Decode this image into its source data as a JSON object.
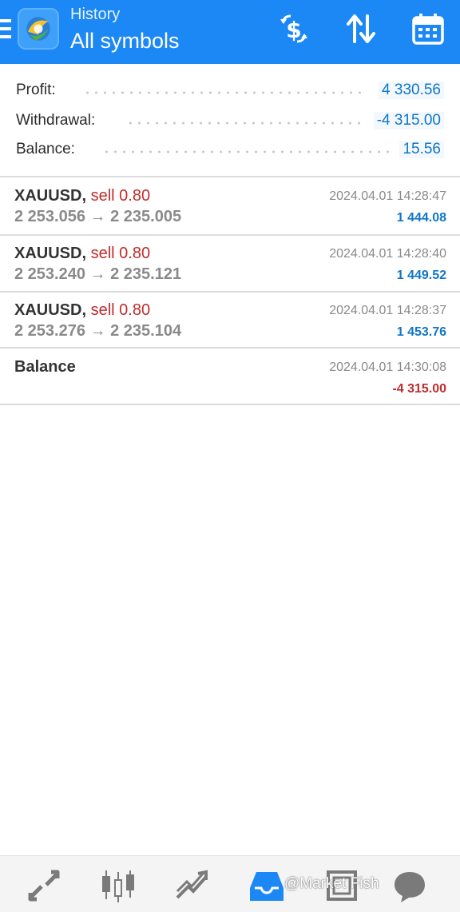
{
  "header": {
    "subtitle": "History",
    "title": "All symbols",
    "icons": [
      "menu-icon",
      "metatrader-logo",
      "dollar-exchange-icon",
      "sort-icon",
      "calendar-icon"
    ],
    "bg_color": "#1c88f5"
  },
  "summary": {
    "profit_label": "Profit:",
    "profit_value": "4 330.56",
    "withdrawal_label": "Withdrawal:",
    "withdrawal_value": "-4 315.00",
    "balance_label": "Balance:",
    "balance_value": "15.56",
    "value_color": "#1176c7"
  },
  "deals": [
    {
      "symbol": "XAUUSD,",
      "side": "sell 0.80",
      "prices": "2 253.056 → 2 235.005",
      "time": "2024.04.01 14:28:47",
      "profit": "1 444.08"
    },
    {
      "symbol": "XAUUSD,",
      "side": "sell 0.80",
      "prices": "2 253.240 → 2 235.121",
      "time": "2024.04.01 14:28:40",
      "profit": "1 449.52"
    },
    {
      "symbol": "XAUUSD,",
      "side": "sell 0.80",
      "prices": "2 253.276 → 2 235.104",
      "time": "2024.04.01 14:28:37",
      "profit": "1 453.76"
    },
    {
      "symbol": "Balance",
      "side": "",
      "prices": "",
      "time": "2024.04.01 14:30:08",
      "profit": "-4 315.00"
    }
  ],
  "colors": {
    "sell": "#c22b2b",
    "positive": "#1176c7",
    "negative": "#c22b2b"
  },
  "bottom_nav": {
    "items": [
      "quotes-icon",
      "chart-icon",
      "trade-icon",
      "history-icon",
      "news-icon",
      "chat-icon"
    ],
    "active": "history-icon",
    "watermark": "@Market Fish"
  }
}
